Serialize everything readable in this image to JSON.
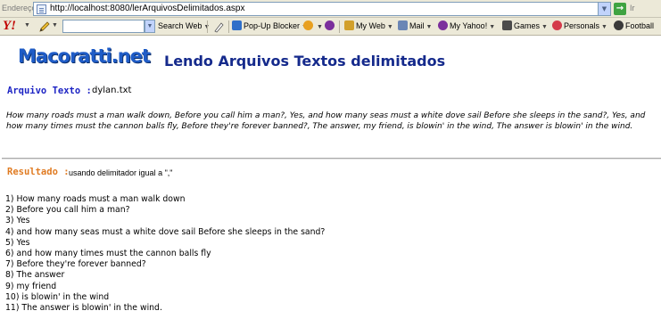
{
  "address_bar": {
    "label": "Endereço",
    "url": "http://localhost:8080/lerArquivosDelimitados.aspx",
    "go_label": "Ir"
  },
  "yahoo_toolbar": {
    "logo": "Y!",
    "search_button": "Search Web",
    "items": [
      {
        "label": "Pop-Up Blocker",
        "icon": "popup-blocker-icon",
        "color": "#2f6fc9"
      },
      {
        "label": "My Web",
        "icon": "my-web-icon",
        "color": "#d2a02b"
      },
      {
        "label": "Mail",
        "icon": "mail-icon",
        "color": "#6b86b5"
      },
      {
        "label": "My Yahoo!",
        "icon": "my-yahoo-icon",
        "color": "#7b2f9c"
      },
      {
        "label": "Games",
        "icon": "games-icon",
        "color": "#4b4b4b"
      },
      {
        "label": "Personals",
        "icon": "personals-icon",
        "color": "#d43a4a"
      },
      {
        "label": "Football",
        "icon": "football-icon",
        "color": "#3a3a3a"
      }
    ]
  },
  "page": {
    "logo": "Macoratti.net",
    "title": "Lendo Arquivos Textos delimitados",
    "arquivo_label": "Arquivo Texto :",
    "arquivo_value": "dylan.txt",
    "lyrics": "How many roads must a man walk down, Before you call him a man?, Yes, and how many seas must a white dove sail Before she sleeps in the sand?, Yes, and how many times must the cannon balls fly, Before they're forever banned?, The answer, my friend, is blowin' in the wind, The answer is blowin' in the wind.",
    "resultado_label": "Resultado :",
    "resultado_value": "usando delimitador igual a \",\"",
    "results": [
      "1) How many roads must a man walk down",
      "2) Before you call him a man?",
      "3) Yes",
      "4) and how many seas must a white dove sail Before she sleeps in the sand?",
      "5) Yes",
      "6) and how many times must the cannon balls fly",
      "7) Before they're forever banned?",
      "8) The answer",
      "9) my friend",
      "10) is blowin' in the wind",
      "11) The answer is blowin' in the wind."
    ]
  },
  "colors": {
    "logo": "#1f5cc7",
    "title": "#152a8c",
    "arquivo_label": "#1d24c4",
    "resultado_label": "#e07b22"
  }
}
